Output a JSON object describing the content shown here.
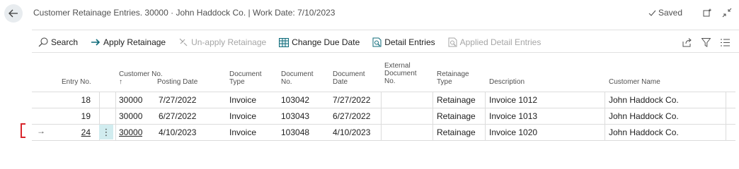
{
  "page": {
    "title": "Customer Retainage Entries. 30000 · John Haddock Co. | Work Date: 7/10/2023",
    "saved_label": "Saved"
  },
  "actions": [
    {
      "label": "Search",
      "icon": "search-icon",
      "enabled": true
    },
    {
      "label": "Apply Retainage",
      "icon": "apply-arrow-icon",
      "enabled": true
    },
    {
      "label": "Un-apply Retainage",
      "icon": "unapply-icon",
      "enabled": false
    },
    {
      "label": "Change Due Date",
      "icon": "calendar-grid-icon",
      "enabled": true
    },
    {
      "label": "Detail Entries",
      "icon": "detail-doc-icon",
      "enabled": true
    },
    {
      "label": "Applied Detail Entries",
      "icon": "applied-doc-icon",
      "enabled": false
    }
  ],
  "columns": {
    "entry_no": "Entry No.",
    "customer_no_l1": "Customer No.",
    "customer_no_l2": "↑",
    "posting_date": "Posting Date",
    "document_type_l1": "Document",
    "document_type_l2": "Type",
    "document_no_l1": "Document",
    "document_no_l2": "No.",
    "document_date_l1": "Document",
    "document_date_l2": "Date",
    "external_doc_l1": "External",
    "external_doc_l2": "Document",
    "external_doc_l3": "No.",
    "retainage_type_l1": "Retainage",
    "retainage_type_l2": "Type",
    "description": "Description",
    "customer_name": "Customer Name"
  },
  "rows": [
    {
      "entry_no": "18",
      "customer_no": "30000",
      "posting_date": "7/27/2022",
      "document_type": "Invoice",
      "document_no": "103042",
      "document_date": "7/27/2022",
      "external_doc_no": "",
      "retainage_type": "Retainage",
      "description": "Invoice 1012",
      "customer_name": "John Haddock Co."
    },
    {
      "entry_no": "19",
      "customer_no": "30000",
      "posting_date": "6/27/2022",
      "document_type": "Invoice",
      "document_no": "103043",
      "document_date": "6/27/2022",
      "external_doc_no": "",
      "retainage_type": "Retainage",
      "description": "Invoice 1013",
      "customer_name": "John Haddock Co."
    },
    {
      "entry_no": "24",
      "customer_no": "30000",
      "posting_date": "4/10/2023",
      "document_type": "Invoice",
      "document_no": "103048",
      "document_date": "4/10/2023",
      "external_doc_no": "",
      "retainage_type": "Retainage",
      "description": "Invoice 1020",
      "customer_name": "John Haddock Co."
    }
  ],
  "selection": {
    "arrow": "→",
    "menu_glyph": "⋮"
  },
  "colors": {
    "accent": "#0f6b7a",
    "selection_cell": "#d1ecef",
    "bracket": "#d9262c"
  }
}
